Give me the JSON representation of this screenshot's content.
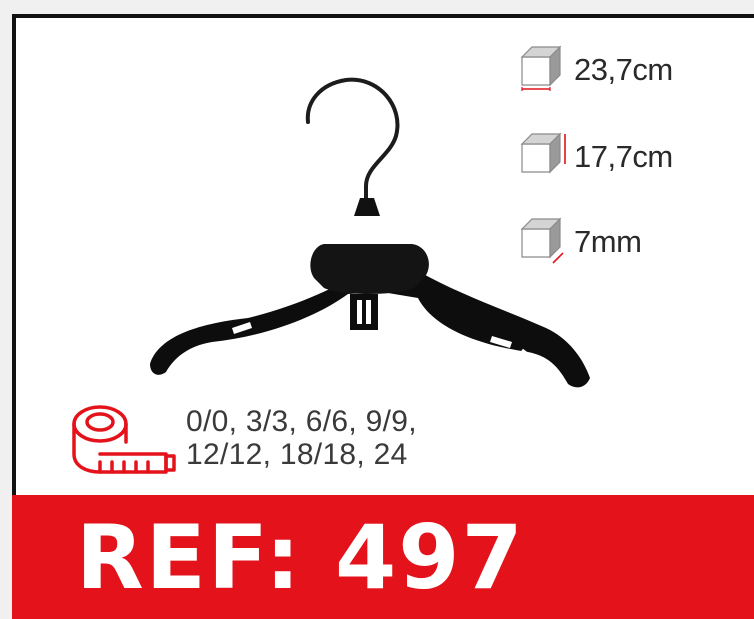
{
  "dimensions": {
    "width": "23,7cm",
    "height": "17,7cm",
    "depth": "7mm"
  },
  "sizes": {
    "line1": "0/0, 3/3, 6/6, 9/9,",
    "line2": "12/12, 18/18, 24"
  },
  "ref": {
    "label": "REF: 497"
  },
  "colors": {
    "accent": "#e3121b",
    "product": "#0d0d0d"
  },
  "icons": [
    "box-width-icon",
    "box-height-icon",
    "box-depth-icon",
    "measuring-tape-icon"
  ]
}
